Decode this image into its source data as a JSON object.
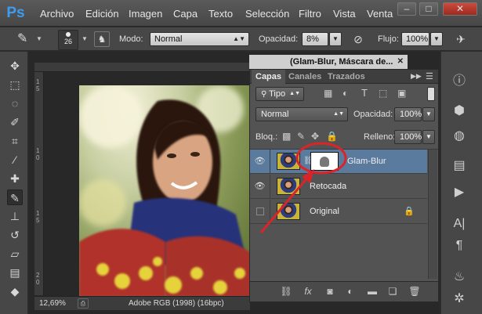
{
  "app": {
    "logo": "Ps"
  },
  "menu": [
    "Archivo",
    "Edición",
    "Imagen",
    "Capa",
    "Texto",
    "Selección",
    "Filtro",
    "Vista",
    "Venta"
  ],
  "window_controls": {
    "minimize": "–",
    "maximize": "□",
    "close": "✕"
  },
  "options": {
    "brush_size": "26",
    "mode_label": "Modo:",
    "mode_value": "Normal",
    "opacity_label": "Opacidad:",
    "opacity_value": "8%",
    "flow_label": "Flujo:",
    "flow_value": "100%"
  },
  "document": {
    "tab_title": "(Glam-Blur, Máscara de...",
    "zoom": "12,69%",
    "profile": "Adobe RGB (1998) (16bpc)",
    "ruler_left": [
      "1",
      "5",
      "1",
      "0",
      "1",
      "5",
      "2",
      "0"
    ]
  },
  "layers_panel": {
    "tabs": [
      "Capas",
      "Canales",
      "Trazados"
    ],
    "filter_value": "Tipo",
    "blend_value": "Normal",
    "opacity_label": "Opacidad:",
    "opacity_value": "100%",
    "lock_label": "Bloq.:",
    "fill_label": "Relleno:",
    "fill_value": "100%",
    "layers": [
      {
        "name": "Glam-Blur",
        "visible": true,
        "selected": true,
        "has_mask": true
      },
      {
        "name": "Retocada",
        "visible": true,
        "selected": false,
        "has_mask": false
      },
      {
        "name": "Original",
        "visible": false,
        "selected": false,
        "has_mask": false,
        "locked": true
      }
    ]
  },
  "colors": {
    "accent": "#3d9cf2",
    "selection": "#5b7b9e",
    "annotation": "#d9252a"
  }
}
